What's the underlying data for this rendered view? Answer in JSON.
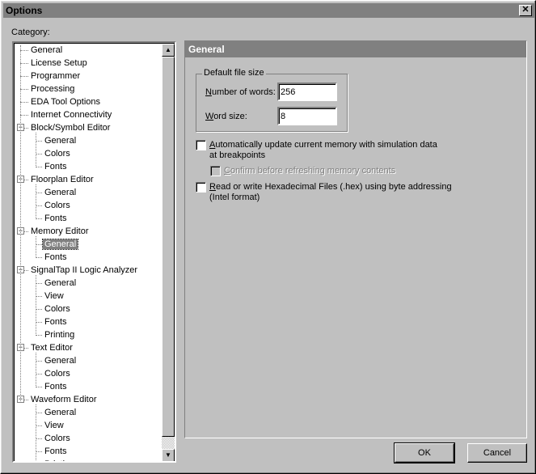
{
  "window": {
    "title": "Options",
    "close_icon": "close-icon"
  },
  "category_label": "Category:",
  "tree": [
    {
      "label": "General",
      "level": 0
    },
    {
      "label": "License Setup",
      "level": 0
    },
    {
      "label": "Programmer",
      "level": 0
    },
    {
      "label": "Processing",
      "level": 0
    },
    {
      "label": "EDA Tool Options",
      "level": 0
    },
    {
      "label": "Internet Connectivity",
      "level": 0
    },
    {
      "label": "Block/Symbol Editor",
      "level": 0,
      "expanded": true
    },
    {
      "label": "General",
      "level": 1
    },
    {
      "label": "Colors",
      "level": 1
    },
    {
      "label": "Fonts",
      "level": 1
    },
    {
      "label": "Floorplan Editor",
      "level": 0,
      "expanded": true
    },
    {
      "label": "General",
      "level": 1
    },
    {
      "label": "Colors",
      "level": 1
    },
    {
      "label": "Fonts",
      "level": 1
    },
    {
      "label": "Memory Editor",
      "level": 0,
      "expanded": true
    },
    {
      "label": "General",
      "level": 1,
      "selected": true
    },
    {
      "label": "Fonts",
      "level": 1
    },
    {
      "label": "SignalTap II Logic Analyzer",
      "level": 0,
      "expanded": true
    },
    {
      "label": "General",
      "level": 1
    },
    {
      "label": "View",
      "level": 1
    },
    {
      "label": "Colors",
      "level": 1
    },
    {
      "label": "Fonts",
      "level": 1
    },
    {
      "label": "Printing",
      "level": 1
    },
    {
      "label": "Text Editor",
      "level": 0,
      "expanded": true
    },
    {
      "label": "General",
      "level": 1
    },
    {
      "label": "Colors",
      "level": 1
    },
    {
      "label": "Fonts",
      "level": 1
    },
    {
      "label": "Waveform Editor",
      "level": 0,
      "expanded": true
    },
    {
      "label": "General",
      "level": 1
    },
    {
      "label": "View",
      "level": 1
    },
    {
      "label": "Colors",
      "level": 1
    },
    {
      "label": "Fonts",
      "level": 1
    },
    {
      "label": "Printing",
      "level": 1
    }
  ],
  "panel": {
    "title": "General",
    "group_label": "Default file size",
    "words_label_key": "N",
    "words_label_rest": "umber of words:",
    "words_value": "256",
    "size_label_key": "W",
    "size_label_rest": "ord size:",
    "size_value": "8",
    "opt1_key": "A",
    "opt1_rest": "utomatically update current memory with simulation data",
    "opt1_line2": "at breakpoints",
    "opt1_checked": false,
    "opt2_key": "C",
    "opt2_rest": "onfirm before refreshing memory contents",
    "opt2_checked": false,
    "opt2_disabled": true,
    "opt3_key": "R",
    "opt3_rest": "ead or write Hexadecimal Files (.hex) using byte addressing",
    "opt3_line2": "(Intel format)",
    "opt3_checked": false
  },
  "buttons": {
    "ok": "OK",
    "cancel": "Cancel"
  }
}
